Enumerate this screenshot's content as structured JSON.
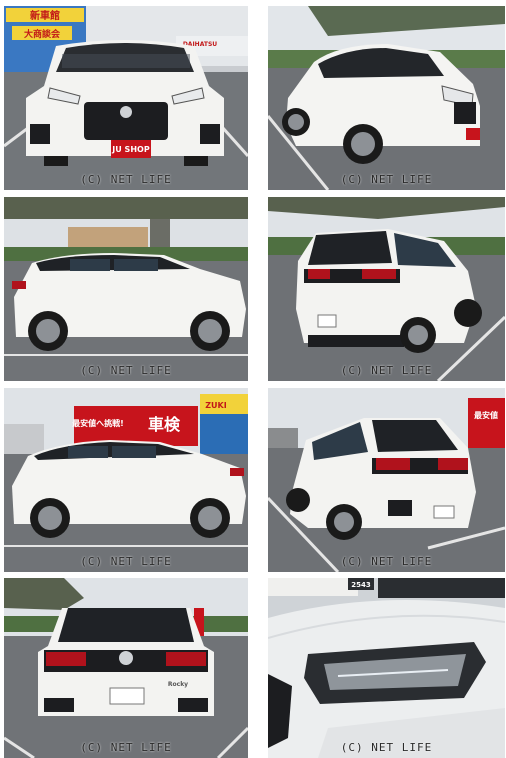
{
  "watermark": "(C) NET LIFE",
  "photos": [
    {
      "view": "front",
      "signs": [
        "新車館",
        "大商談会",
        "DAIHATSU",
        "JU SHOP"
      ]
    },
    {
      "view": "front-three-quarter-right",
      "signs": []
    },
    {
      "view": "left-side",
      "signs": []
    },
    {
      "view": "rear-three-quarter-left",
      "signs": []
    },
    {
      "view": "left-side-dealer",
      "signs": [
        "最安値へ挑戦!",
        "車検",
        "ZUKI"
      ]
    },
    {
      "view": "rear-three-quarter-right",
      "signs": [
        "最安値"
      ]
    },
    {
      "view": "rear",
      "signs": [
        "Rocky"
      ]
    },
    {
      "view": "headlight-closeup",
      "signs": [
        "2543"
      ]
    }
  ],
  "colors": {
    "body": "#f2f2f0",
    "roof": "#1e1f22",
    "tail": "#b0121c",
    "sky": "#dfe3e8",
    "asphalt": "#6d7074",
    "line": "#e9e9e9"
  }
}
